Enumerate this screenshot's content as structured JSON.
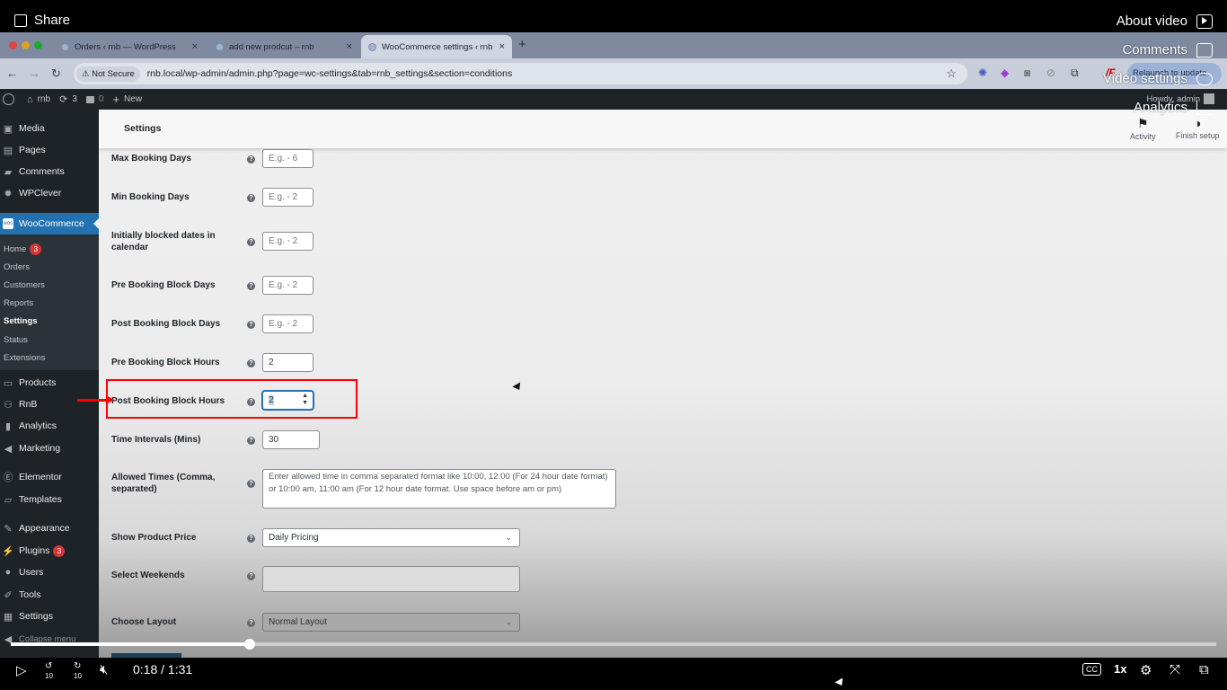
{
  "video": {
    "share_label": "Share",
    "about_label": "About video",
    "comments_label": "Comments",
    "video_settings_label": "Video settings",
    "analytics_label": "Analytics",
    "time_current": "0:18",
    "time_total": "1:31",
    "time_display": "0:18 / 1:31",
    "progress": 0.198,
    "speed_label": "1x",
    "rewind_label": "10",
    "forward_label": "10"
  },
  "browser": {
    "tabs": [
      {
        "title": "Orders ‹ rnb — WordPress",
        "active": false
      },
      {
        "title": "add new prodcut – rnb",
        "active": false
      },
      {
        "title": "WooCommerce settings ‹ rnb",
        "active": true
      }
    ],
    "security_label": "Not Secure",
    "url": "rnb.local/wp-admin/admin.php?page=wc-settings&tab=rnb_settings&section=conditions",
    "relaunch_label": "Relaunch to update"
  },
  "adminbar": {
    "site_name": "rnb",
    "updates_count": "3",
    "comments_count": "0",
    "new_label": "New",
    "howdy": "Howdy, admin"
  },
  "sidebar": {
    "items": [
      {
        "label": "Media",
        "icon": "media-icon"
      },
      {
        "label": "Pages",
        "icon": "pages-icon"
      },
      {
        "label": "Comments",
        "icon": "comments-icon"
      },
      {
        "label": "WPClever",
        "icon": "wpclever-icon"
      },
      {
        "label": "WooCommerce",
        "icon": "woocommerce-icon",
        "active": true
      },
      {
        "label": "Products",
        "icon": "products-icon"
      },
      {
        "label": "RnB",
        "icon": "rnb-icon"
      },
      {
        "label": "Analytics",
        "icon": "analytics-icon"
      },
      {
        "label": "Marketing",
        "icon": "marketing-icon"
      },
      {
        "label": "Elementor",
        "icon": "elementor-icon"
      },
      {
        "label": "Templates",
        "icon": "templates-icon"
      },
      {
        "label": "Appearance",
        "icon": "appearance-icon"
      },
      {
        "label": "Plugins",
        "icon": "plugins-icon",
        "badge": "3"
      },
      {
        "label": "Users",
        "icon": "users-icon"
      },
      {
        "label": "Tools",
        "icon": "tools-icon"
      },
      {
        "label": "Settings",
        "icon": "settings-icon"
      },
      {
        "label": "Collapse menu",
        "icon": "collapse-icon"
      }
    ],
    "submenu": [
      {
        "label": "Home",
        "badge": "3"
      },
      {
        "label": "Orders"
      },
      {
        "label": "Customers"
      },
      {
        "label": "Reports"
      },
      {
        "label": "Settings",
        "current": true
      },
      {
        "label": "Status"
      },
      {
        "label": "Extensions"
      }
    ]
  },
  "header": {
    "title": "Settings",
    "activity_label": "Activity",
    "finish_setup_label": "Finish setup"
  },
  "form": {
    "rows": [
      {
        "label": "Max Booking Days",
        "placeholder": "E.g. - 6",
        "value": ""
      },
      {
        "label": "Min Booking Days",
        "placeholder": "E.g. - 2",
        "value": ""
      },
      {
        "label": "Initially blocked dates in calendar",
        "placeholder": "E.g. - 2",
        "value": ""
      },
      {
        "label": "Pre Booking Block Days",
        "placeholder": "E.g. - 2",
        "value": ""
      },
      {
        "label": "Post Booking Block Days",
        "placeholder": "E.g. - 2",
        "value": ""
      },
      {
        "label": "Pre Booking Block Hours",
        "placeholder": "",
        "value": "2"
      },
      {
        "label": "Post Booking Block Hours",
        "placeholder": "",
        "value": "2",
        "focused": true
      },
      {
        "label": "Time Intervals (Mins)",
        "placeholder": "",
        "value": "30"
      },
      {
        "label": "Allowed Times (Comma, separated)",
        "placeholder": "Enter allowed time in comma separated format like 10:00, 12:00 (For 24 hour date format) or 10:00 am, 11:00 am (For 12 hour date format. Use space before am or pm)",
        "value": ""
      },
      {
        "label": "Show Product Price",
        "selected": "Daily Pricing"
      },
      {
        "label": "Select Weekends",
        "value": ""
      },
      {
        "label": "Choose Layout",
        "selected": "Normal Layout"
      }
    ],
    "help_glyph": "?"
  }
}
